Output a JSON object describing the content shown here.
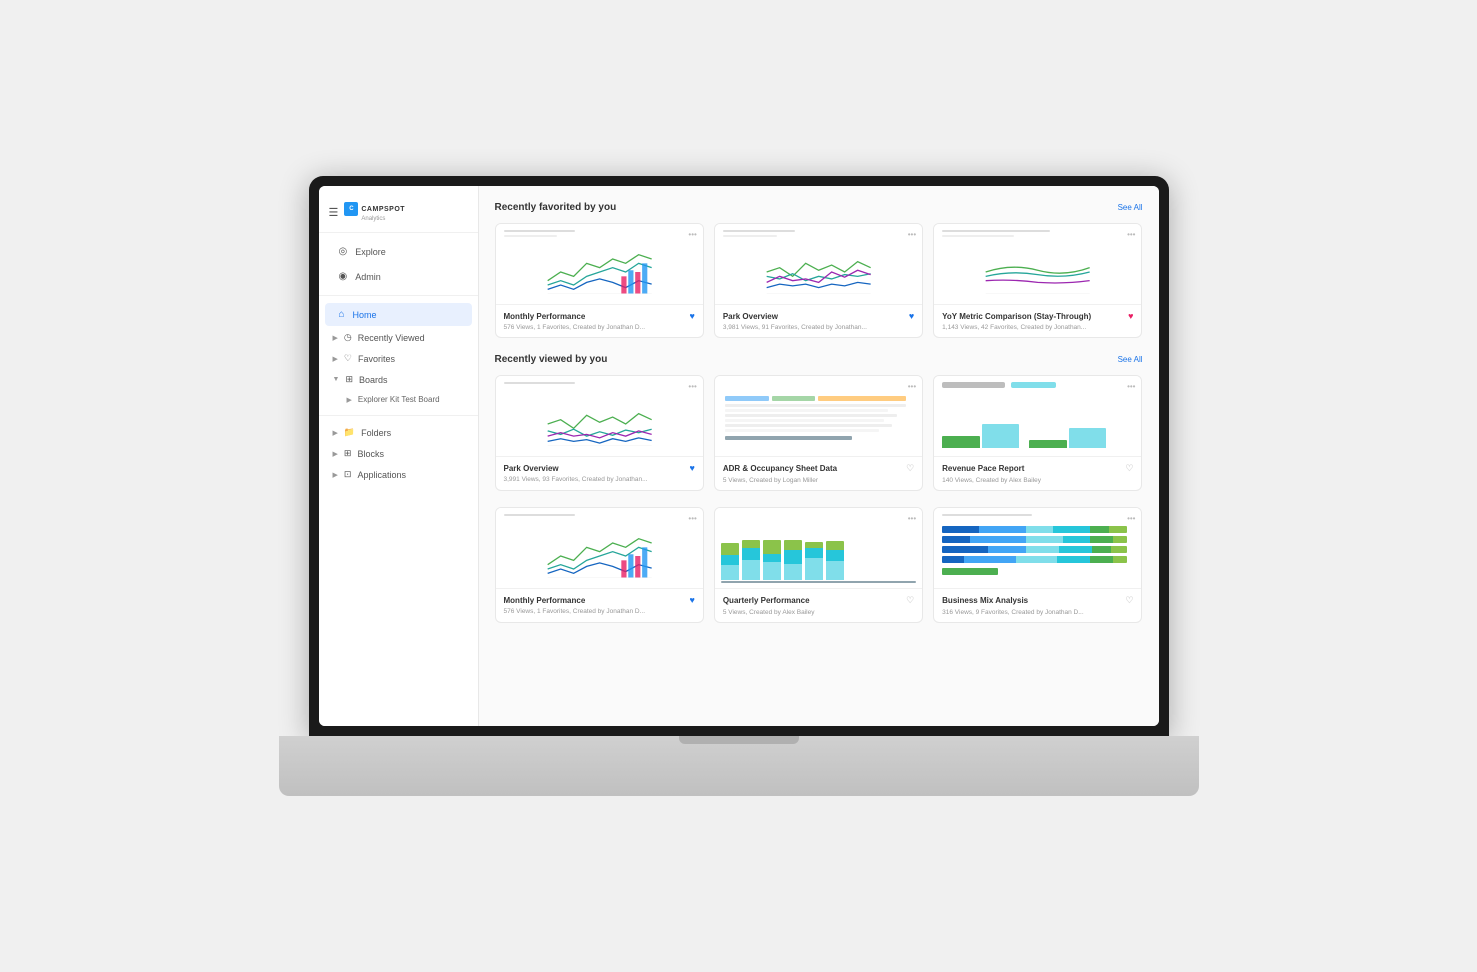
{
  "app": {
    "logo_text": "CAMPSPOT",
    "logo_sub": "Analytics"
  },
  "sidebar": {
    "hamburger": "☰",
    "items": [
      {
        "id": "explore",
        "label": "Explore",
        "icon": "◎",
        "active": false
      },
      {
        "id": "admin",
        "label": "Admin",
        "icon": "◉",
        "active": false
      },
      {
        "id": "home",
        "label": "Home",
        "icon": "⌂",
        "active": true
      }
    ],
    "recently_viewed": {
      "label": "Recently Viewed",
      "icon": "◷",
      "arrow": "▶"
    },
    "favorites": {
      "label": "Favorites",
      "icon": "♡",
      "arrow": "▶"
    },
    "boards": {
      "label": "Boards",
      "icon": "",
      "arrow": "▼",
      "sub_items": [
        {
          "label": "Explorer Kit Test Board",
          "arrow": "▶"
        }
      ]
    },
    "folders": {
      "label": "Folders",
      "icon": "🗂",
      "arrow": "▶"
    },
    "blocks": {
      "label": "Blocks",
      "icon": "⊞",
      "arrow": "▶"
    },
    "applications": {
      "label": "Applications",
      "icon": "⊡",
      "arrow": "▶"
    }
  },
  "recently_favorited": {
    "title": "Recently favorited by you",
    "see_all": "See All",
    "cards": [
      {
        "id": "monthly-perf-1",
        "title": "Monthly Performance",
        "meta": "576 Views, 1 Favorites, Created by Jonathan D...",
        "favorited": true,
        "chart_type": "line_bar"
      },
      {
        "id": "park-overview-1",
        "title": "Park Overview",
        "meta": "3,981 Views, 91 Favorites, Created by Jonathan...",
        "favorited": true,
        "chart_type": "multi_line"
      },
      {
        "id": "yoy-metric",
        "title": "YoY Metric Comparison (Stay-Through)",
        "meta": "1,143 Views, 42 Favorites, Created by Jonathan...",
        "favorited": true,
        "chart_type": "smooth_line"
      }
    ]
  },
  "recently_viewed": {
    "title": "Recently viewed by you",
    "see_all": "See All",
    "cards": [
      {
        "id": "park-overview-2",
        "title": "Park Overview",
        "meta": "3,991 Views, 93 Favorites, Created by Jonathan...",
        "favorited": true,
        "chart_type": "multi_line_2"
      },
      {
        "id": "adr-occupancy",
        "title": "ADR & Occupancy Sheet Data",
        "meta": "5 Views, Created by Logan Miller",
        "favorited": false,
        "chart_type": "table"
      },
      {
        "id": "revenue-pace",
        "title": "Revenue Pace Report",
        "meta": "140 Views, Created by Alex Bailey",
        "favorited": false,
        "chart_type": "bar_simple"
      }
    ]
  },
  "section3": {
    "cards": [
      {
        "id": "monthly-perf-2",
        "title": "Monthly Performance",
        "meta": "576 Views, 1 Favorites, Created by Jonathan D...",
        "favorited": true,
        "chart_type": "line_bar"
      },
      {
        "id": "quarterly-perf",
        "title": "Quarterly Performance",
        "meta": "5 Views, Created by Alex Bailey",
        "favorited": false,
        "chart_type": "stacked_bar"
      },
      {
        "id": "business-mix",
        "title": "Business Mix Analysis",
        "meta": "316 Views, 9 Favorites, Created by Jonathan D...",
        "favorited": false,
        "chart_type": "horizontal_bar"
      }
    ]
  },
  "colors": {
    "accent": "#1a73e8",
    "green": "#4caf50",
    "teal": "#26a69a",
    "purple": "#9c27b0",
    "pink": "#e91e63",
    "blue": "#2196F3",
    "olive": "#8bc34a",
    "orange": "#ff9800",
    "light_blue": "#80deea",
    "dark_blue": "#1565c0",
    "gray_bar": "#90a4ae"
  }
}
